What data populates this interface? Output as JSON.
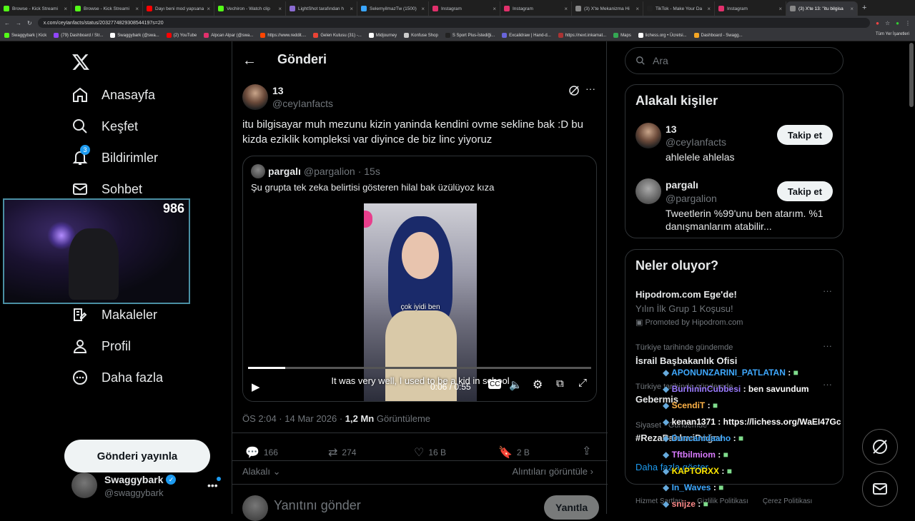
{
  "browser": {
    "tabs": [
      {
        "label": "Browse - Kick Streami",
        "color": "#53fc18"
      },
      {
        "label": "Browse - Kick Streami",
        "color": "#53fc18"
      },
      {
        "label": "Dayı beni mod yapsana",
        "color": "#ff0000"
      },
      {
        "label": "Vechiron - Watch clip",
        "color": "#53fc18"
      },
      {
        "label": "LightShot tarafından h",
        "color": "#8a6bd1"
      },
      {
        "label": "SelemyilmazTw (1500)",
        "color": "#3aa6ff"
      },
      {
        "label": "Instagram",
        "color": "#e1306c"
      },
      {
        "label": "Instagram",
        "color": "#e1306c"
      },
      {
        "label": "(3) X'te Mekanizma Hi",
        "color": "#888888"
      },
      {
        "label": "TikTok - Make Your Da",
        "color": "#222222"
      },
      {
        "label": "Instagram",
        "color": "#e1306c"
      },
      {
        "label": "(3) X'te 13: \"itu bilgisa",
        "color": "#888888"
      }
    ],
    "url": "x.com/ceyIanfacts/status/2032774829308544197s=20",
    "bookmarks": [
      {
        "label": "Swaggybark | Kick",
        "color": "#53fc18"
      },
      {
        "label": "(79) Dashboard / Str...",
        "color": "#9146ff"
      },
      {
        "label": "Swaggybark (@swa...",
        "color": "#ffffff"
      },
      {
        "label": "(2) YouTube",
        "color": "#ff0000"
      },
      {
        "label": "Alpcan Alpar (@swa...",
        "color": "#e1306c"
      },
      {
        "label": "https://www.reddit....",
        "color": "#ff4500"
      },
      {
        "label": "Gelen Kutusu (31) -...",
        "color": "#ea4335"
      },
      {
        "label": "Midjourney",
        "color": "#ffffff"
      },
      {
        "label": "Konfuse Shop",
        "color": "#cccccc"
      },
      {
        "label": "S Sport Plus-İstediği...",
        "color": "#222222"
      },
      {
        "label": "Excalidraw | Hand-d...",
        "color": "#6965db"
      },
      {
        "label": "https://next.inkarnat...",
        "color": "#aa3333"
      },
      {
        "label": "Maps",
        "color": "#34a853"
      },
      {
        "label": "lichess.org • Ücretsi...",
        "color": "#ffffff"
      },
      {
        "label": "Dashboard - Swagg...",
        "color": "#f5a623"
      }
    ],
    "all_bookmarks": "Tüm Yer İşaretleri"
  },
  "nav": {
    "items": [
      "Anasayfa",
      "Keşfet",
      "Bildirimler",
      "Sohbet",
      "Makaleler",
      "Profil",
      "Daha fazla"
    ],
    "notif_count": "3",
    "post_button": "Gönderi yayınla",
    "account_name": "Swaggybark",
    "account_handle": "@swaggybark",
    "viewers": "986"
  },
  "main": {
    "header": "Gönderi",
    "author_name": "13",
    "author_handle": "@ceyIanfacts",
    "text": "itu bilgisayar muh mezunu kizin yaninda kendini ovme sekline bak :D bu kizda eziklik kompleksi var diyince de biz linc yiyoruz",
    "quote": {
      "name": "pargalı",
      "handle": "@pargalion",
      "time": "· 15s",
      "text": "Şu grupta tek zeka belirtisi gösteren hilal bak üzülüyoz kıza",
      "subtitle_in_video": "çok iyidi ben",
      "caption": "It was very well, I used to be a kid in school",
      "time_display": "0:06 / 0:55",
      "progress": 0.109
    },
    "meta_time": "ÖS 2:04 · 14 Mar 2026 · ",
    "views": "1,2 Mn",
    "views_label": "Görüntüleme",
    "stats": {
      "replies": "166",
      "reposts": "274",
      "likes": "16 B",
      "bookmarks": "2 B"
    },
    "relevant": "Alakalı",
    "quotes_link": "Alıntıları görüntüle",
    "reply_placeholder": "Yanıtını gönder",
    "reply_button": "Yanıtla"
  },
  "right": {
    "search_placeholder": "Ara",
    "people_title": "Alakalı kişiler",
    "people": [
      {
        "name": "13",
        "handle": "@ceyIanfacts",
        "bio": "ahlelele ahlelas",
        "follow": "Takip et"
      },
      {
        "name": "pargalı",
        "handle": "@pargalion",
        "bio": "Tweetlerin %99'unu ben atarım. %1 danışmanlarım atabilir...",
        "follow": "Takip et"
      }
    ],
    "trends_title": "Neler oluyor?",
    "promo_title": "Hipodrom.com Ege'de!",
    "promo_sub": "Yılın İlk Grup 1 Koşusu!",
    "promo_by": "Promoted by Hipodrom.com",
    "trends": [
      {
        "context": "Türkiye tarihinde gündemde",
        "name": "İsrail Başbakanlık Ofisi"
      },
      {
        "context": "Türkiye tarihinde gündemde",
        "name": "Gebermiş"
      },
      {
        "context": "Siyaset · Gündemde",
        "name": "#RezaPahlaviDoğru"
      }
    ],
    "show_more": "Daha fazla göster",
    "footer": [
      "Hizmet Şartları",
      "Gizlilik Politikası",
      "Çerez Politikası"
    ]
  },
  "chat": [
    {
      "user": "APONUNZARINI_PATLATAN",
      "msg": "",
      "color": "#3fa9ff"
    },
    {
      "user": "BurhininCubbesi",
      "msg": "ben savundum",
      "color": "#9b7bff"
    },
    {
      "user": "ScendiT",
      "msg": "",
      "color": "#ffb347"
    },
    {
      "user": "kenan1371",
      "msg": "https://lichess.org/WaEI47Gc",
      "color": "#ffffff"
    },
    {
      "user": "Duncanidaaho",
      "msg": "",
      "color": "#3fa9ff"
    },
    {
      "user": "Tftbilmiom",
      "msg": "",
      "color": "#d97aff"
    },
    {
      "user": "KAPTORXX",
      "msg": "",
      "color": "#ffe800"
    },
    {
      "user": "In_Waves",
      "msg": "",
      "color": "#3fa9ff"
    },
    {
      "user": "snijze",
      "msg": "",
      "color": "#ff8a8a"
    }
  ]
}
